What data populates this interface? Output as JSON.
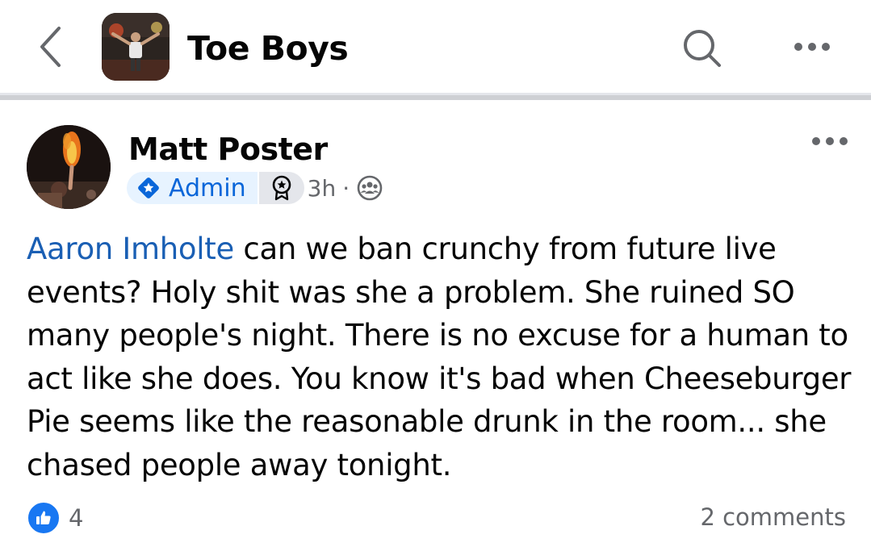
{
  "header": {
    "group_title": "Toe Boys"
  },
  "post": {
    "author_name": "Matt Poster",
    "badge_label": "Admin",
    "timestamp": "3h",
    "separator": "·",
    "mention": "Aaron Imholte",
    "body": " can we ban crunchy from future live events? Holy shit was she a problem. She ruined SO many people's night. There is no excuse for a human to act like she does. You know it's bad when Cheeseburger Pie seems like the reasonable drunk in the room... she chased people away tonight.",
    "like_count": "4",
    "comments_label": "2 comments"
  },
  "colors": {
    "accent": "#1877f2",
    "mention": "#1a5fb4",
    "secondary_text": "#65676b"
  },
  "icons": {
    "back": "chevron-left-icon",
    "search": "search-icon",
    "more": "more-horizontal-icon",
    "admin": "admin-diamond-icon",
    "rank": "rank-medal-icon",
    "audience": "group-audience-icon",
    "like": "thumbs-up-icon"
  }
}
